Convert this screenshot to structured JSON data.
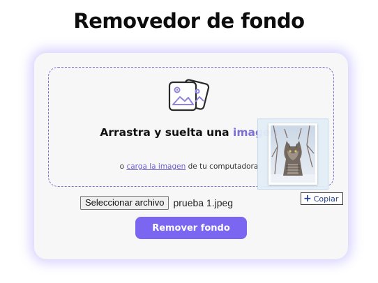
{
  "header": {
    "title": "Removedor de fondo"
  },
  "dropzone": {
    "title_prefix": "Arrastra y suelta una ",
    "title_accent": "imagen",
    "sub_prefix": "o ",
    "sub_link": "carga la imagen",
    "sub_suffix": " de tu computadora",
    "icon": "images-icon",
    "drag_preview": "cat-photo-thumbnail",
    "drag_badge_icon": "plus-icon",
    "drag_badge_label": "Copiar"
  },
  "file_input": {
    "button_label": "Seleccionar archivo",
    "file_name": "prueba 1.jpeg"
  },
  "actions": {
    "remove_label": "Remover fondo"
  },
  "colors": {
    "accent": "#7b6fd6",
    "button": "#7b66f2",
    "card_bg": "#f7f7f7",
    "glow": "#b9a8ff"
  }
}
